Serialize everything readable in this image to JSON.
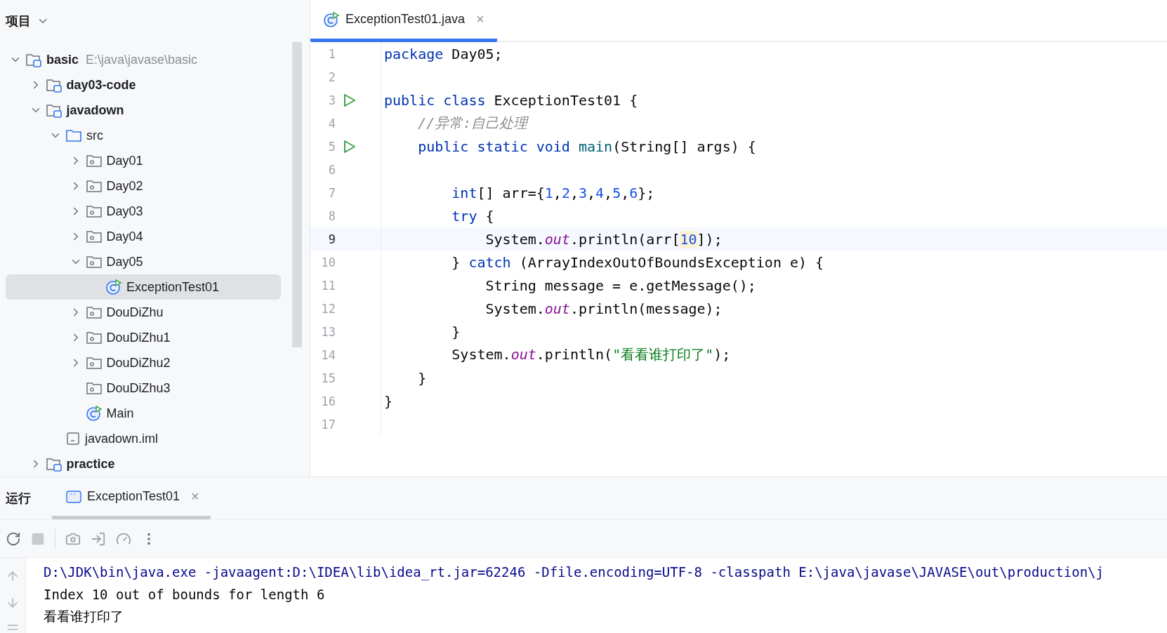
{
  "sidebar": {
    "title": "项目",
    "tree": [
      {
        "label": "basic",
        "hint": "E:\\java\\javase\\basic",
        "kind": "module",
        "bold": true,
        "expanded": true,
        "selected": false,
        "children": [
          {
            "label": "day03-code",
            "kind": "module",
            "bold": true,
            "expanded": false,
            "selected": false
          },
          {
            "label": "javadown",
            "kind": "module",
            "bold": true,
            "expanded": true,
            "selected": false,
            "children": [
              {
                "label": "src",
                "kind": "folder",
                "bold": false,
                "expanded": true,
                "selected": false,
                "children": [
                  {
                    "label": "Day01",
                    "kind": "package",
                    "bold": false,
                    "expanded": false,
                    "selected": false
                  },
                  {
                    "label": "Day02",
                    "kind": "package",
                    "bold": false,
                    "expanded": false,
                    "selected": false
                  },
                  {
                    "label": "Day03",
                    "kind": "package",
                    "bold": false,
                    "expanded": false,
                    "selected": false
                  },
                  {
                    "label": "Day04",
                    "kind": "package",
                    "bold": false,
                    "expanded": false,
                    "selected": false
                  },
                  {
                    "label": "Day05",
                    "kind": "package",
                    "bold": false,
                    "expanded": true,
                    "selected": false,
                    "children": [
                      {
                        "label": "ExceptionTest01",
                        "kind": "class",
                        "bold": false,
                        "selected": true
                      }
                    ]
                  },
                  {
                    "label": "DouDiZhu",
                    "kind": "package",
                    "bold": false,
                    "expanded": false,
                    "selected": false
                  },
                  {
                    "label": "DouDiZhu1",
                    "kind": "package",
                    "bold": false,
                    "expanded": false,
                    "selected": false
                  },
                  {
                    "label": "DouDiZhu2",
                    "kind": "package",
                    "bold": false,
                    "expanded": false,
                    "selected": false
                  },
                  {
                    "label": "DouDiZhu3",
                    "kind": "package",
                    "bold": false,
                    "selected": false
                  },
                  {
                    "label": "Main",
                    "kind": "class",
                    "bold": false,
                    "selected": false
                  }
                ]
              },
              {
                "label": "javadown.iml",
                "kind": "file",
                "bold": false,
                "selected": false
              }
            ]
          },
          {
            "label": "practice",
            "kind": "module",
            "bold": true,
            "expanded": false,
            "selected": false
          }
        ]
      }
    ]
  },
  "editor": {
    "tabs": [
      {
        "label": "ExceptionTest01.java",
        "close": "×",
        "selected": true
      }
    ],
    "lines": [
      {
        "number": "1",
        "run": false,
        "current": false,
        "tokens": [
          {
            "kind": "keyword",
            "text": "package"
          },
          {
            "kind": "plain",
            "text": " Day05;"
          }
        ]
      },
      {
        "number": "2",
        "run": false,
        "current": false
      },
      {
        "number": "3",
        "run": true,
        "current": false,
        "tokens": [
          {
            "kind": "keyword",
            "text": "public class"
          },
          {
            "kind": "plain",
            "text": " ExceptionTest01 {"
          }
        ]
      },
      {
        "number": "4",
        "run": false,
        "current": false,
        "tokens": [
          {
            "kind": "comment",
            "text": "    //异常:自己处理"
          }
        ]
      },
      {
        "number": "5",
        "run": true,
        "current": false,
        "tokens": [
          {
            "kind": "keyword",
            "text": "    public static void"
          },
          {
            "kind": "method",
            "text": " main"
          },
          {
            "kind": "plain",
            "text": "(String[] args) {"
          }
        ]
      },
      {
        "number": "6",
        "run": false,
        "current": false
      },
      {
        "number": "7",
        "run": false,
        "current": false,
        "tokens": [
          {
            "kind": "keyword",
            "text": "        int"
          },
          {
            "kind": "plain",
            "text": "[] arr={"
          },
          {
            "kind": "number",
            "text": "1"
          },
          {
            "kind": "plain",
            "text": ","
          },
          {
            "kind": "number",
            "text": "2"
          },
          {
            "kind": "plain",
            "text": ","
          },
          {
            "kind": "number",
            "text": "3"
          },
          {
            "kind": "plain",
            "text": ","
          },
          {
            "kind": "number",
            "text": "4"
          },
          {
            "kind": "plain",
            "text": ","
          },
          {
            "kind": "number",
            "text": "5"
          },
          {
            "kind": "plain",
            "text": ","
          },
          {
            "kind": "number",
            "text": "6"
          },
          {
            "kind": "plain",
            "text": "};"
          }
        ]
      },
      {
        "number": "8",
        "run": false,
        "current": false,
        "tokens": [
          {
            "kind": "keyword",
            "text": "        try"
          },
          {
            "kind": "plain",
            "text": " {"
          }
        ]
      },
      {
        "number": "9",
        "run": false,
        "current": true,
        "tokens": [
          {
            "kind": "plain",
            "text": "            System."
          },
          {
            "kind": "field",
            "text": "out"
          },
          {
            "kind": "plain",
            "text": ".println(arr["
          },
          {
            "kind": "match",
            "text": "10"
          },
          {
            "kind": "plain",
            "text": "]);"
          }
        ]
      },
      {
        "number": "10",
        "run": false,
        "current": false,
        "tokens": [
          {
            "kind": "plain",
            "text": "        } "
          },
          {
            "kind": "keyword",
            "text": "catch"
          },
          {
            "kind": "plain",
            "text": " (ArrayIndexOutOfBoundsException e) {"
          }
        ]
      },
      {
        "number": "11",
        "run": false,
        "current": false,
        "tokens": [
          {
            "kind": "plain",
            "text": "            String message = e.getMessage();"
          }
        ]
      },
      {
        "number": "12",
        "run": false,
        "current": false,
        "tokens": [
          {
            "kind": "plain",
            "text": "            System."
          },
          {
            "kind": "field",
            "text": "out"
          },
          {
            "kind": "plain",
            "text": ".println(message);"
          }
        ]
      },
      {
        "number": "13",
        "run": false,
        "current": false,
        "tokens": [
          {
            "kind": "plain",
            "text": "        }"
          }
        ]
      },
      {
        "number": "14",
        "run": false,
        "current": false,
        "tokens": [
          {
            "kind": "plain",
            "text": "        System."
          },
          {
            "kind": "field",
            "text": "out"
          },
          {
            "kind": "plain",
            "text": ".println("
          },
          {
            "kind": "string",
            "text": "\"看看谁打印了\""
          },
          {
            "kind": "plain",
            "text": ");"
          }
        ]
      },
      {
        "number": "15",
        "run": false,
        "current": false,
        "tokens": [
          {
            "kind": "plain",
            "text": "    }"
          }
        ]
      },
      {
        "number": "16",
        "run": false,
        "current": false,
        "tokens": [
          {
            "kind": "plain",
            "text": "}"
          }
        ]
      },
      {
        "number": "17",
        "run": false,
        "current": false
      }
    ]
  },
  "run_panel": {
    "title": "运行",
    "tabs": [
      {
        "label": "ExceptionTest01",
        "close": "×",
        "selected": true
      }
    ],
    "console": [
      {
        "kind": "command",
        "text": "D:\\JDK\\bin\\java.exe -javaagent:D:\\IDEA\\lib\\idea_rt.jar=62246 -Dfile.encoding=UTF-8 -classpath E:\\java\\javase\\JAVASE\\out\\production\\j"
      },
      {
        "kind": "output",
        "text": "Index 10 out of bounds for length 6"
      },
      {
        "kind": "output",
        "text": "看看谁打印了"
      }
    ]
  }
}
